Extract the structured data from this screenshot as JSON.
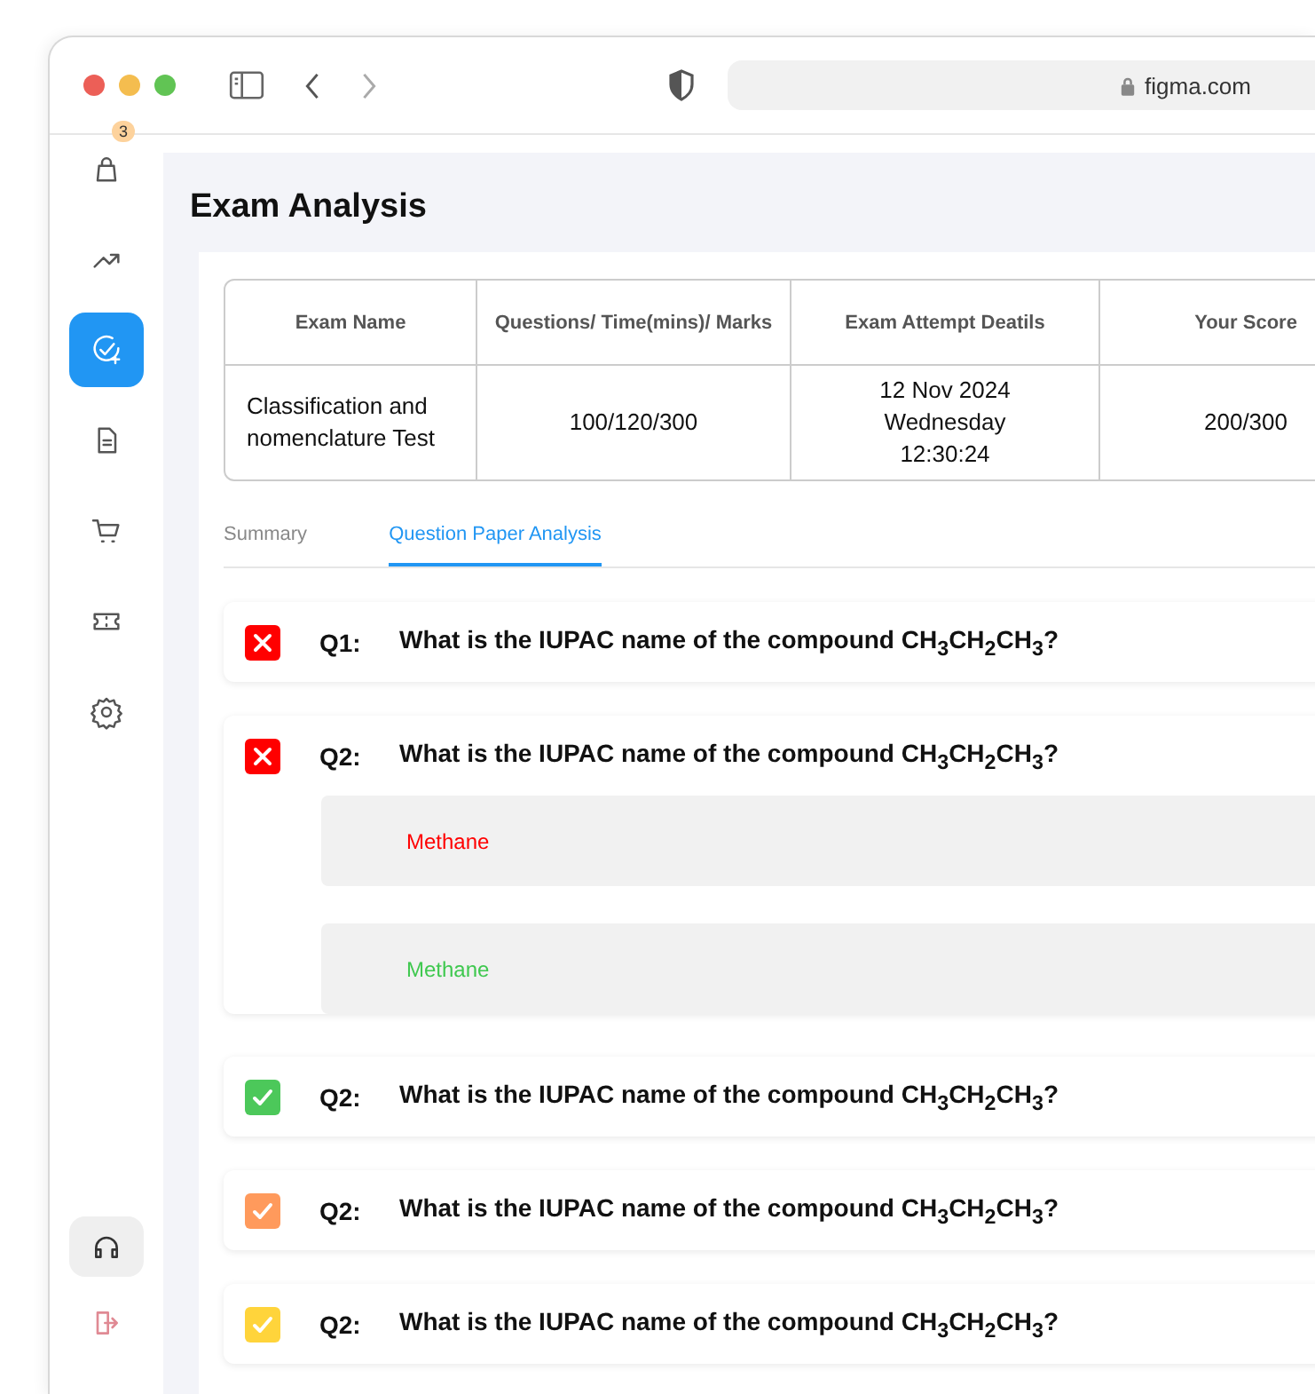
{
  "browser": {
    "address": "figma.com"
  },
  "sidebar": {
    "items": [
      {
        "selected": false,
        "badge": "3"
      },
      {
        "selected": false
      },
      {
        "selected": true
      },
      {
        "selected": false
      },
      {
        "selected": false
      },
      {
        "selected": false
      },
      {
        "selected": false
      }
    ],
    "bottom_items": [
      {
        "selected": true
      },
      {
        "selected": false
      }
    ]
  },
  "page": {
    "title": "Exam Analysis"
  },
  "table": {
    "columns": [
      "Exam Name",
      "Questions/ Time(mins)/ Marks",
      "Exam Attempt Deatils",
      "Your Score"
    ],
    "rows": [
      [
        [
          "Classification and nomenclature Test"
        ],
        [
          "100/120/300"
        ],
        [
          "12 Nov 2024",
          "Wednesday",
          "12:30:24"
        ],
        [
          "200/300"
        ]
      ]
    ]
  },
  "tabs": [
    {
      "label": "Summary",
      "selected": false
    },
    {
      "label": "Question Paper Analysis",
      "selected": true
    }
  ],
  "questions": [
    {
      "number": "Q1:",
      "text": "What is the IUPAC name of the compound CH$_{3}$CH$_{2}$CH$_{3}$?",
      "kind": "cross",
      "color": "#ff0000"
    },
    {
      "number": "Q2:",
      "text": "What is the IUPAC name of the compound CH$_{3}$CH$_{2}$CH$_{3}$?",
      "kind": "cross",
      "color": "#ff0000",
      "answers": [
        {
          "text": "Methane",
          "color": "#ff0000"
        },
        {
          "text": "Methane",
          "color": "#3fc84f"
        }
      ]
    },
    {
      "number": "Q2:",
      "text": "What is the IUPAC name of the compound CH$_{3}$CH$_{2}$CH$_{3}$?",
      "kind": "check",
      "color": "#4cc85a"
    },
    {
      "number": "Q2:",
      "text": "What is the IUPAC name of the compound CH$_{3}$CH$_{2}$CH$_{3}$?",
      "kind": "check",
      "color": "#ff9a5c"
    },
    {
      "number": "Q2:",
      "text": "What is the IUPAC name of the compound CH$_{3}$CH$_{2}$CH$_{3}$?",
      "kind": "check",
      "color": "#ffd43b"
    }
  ]
}
